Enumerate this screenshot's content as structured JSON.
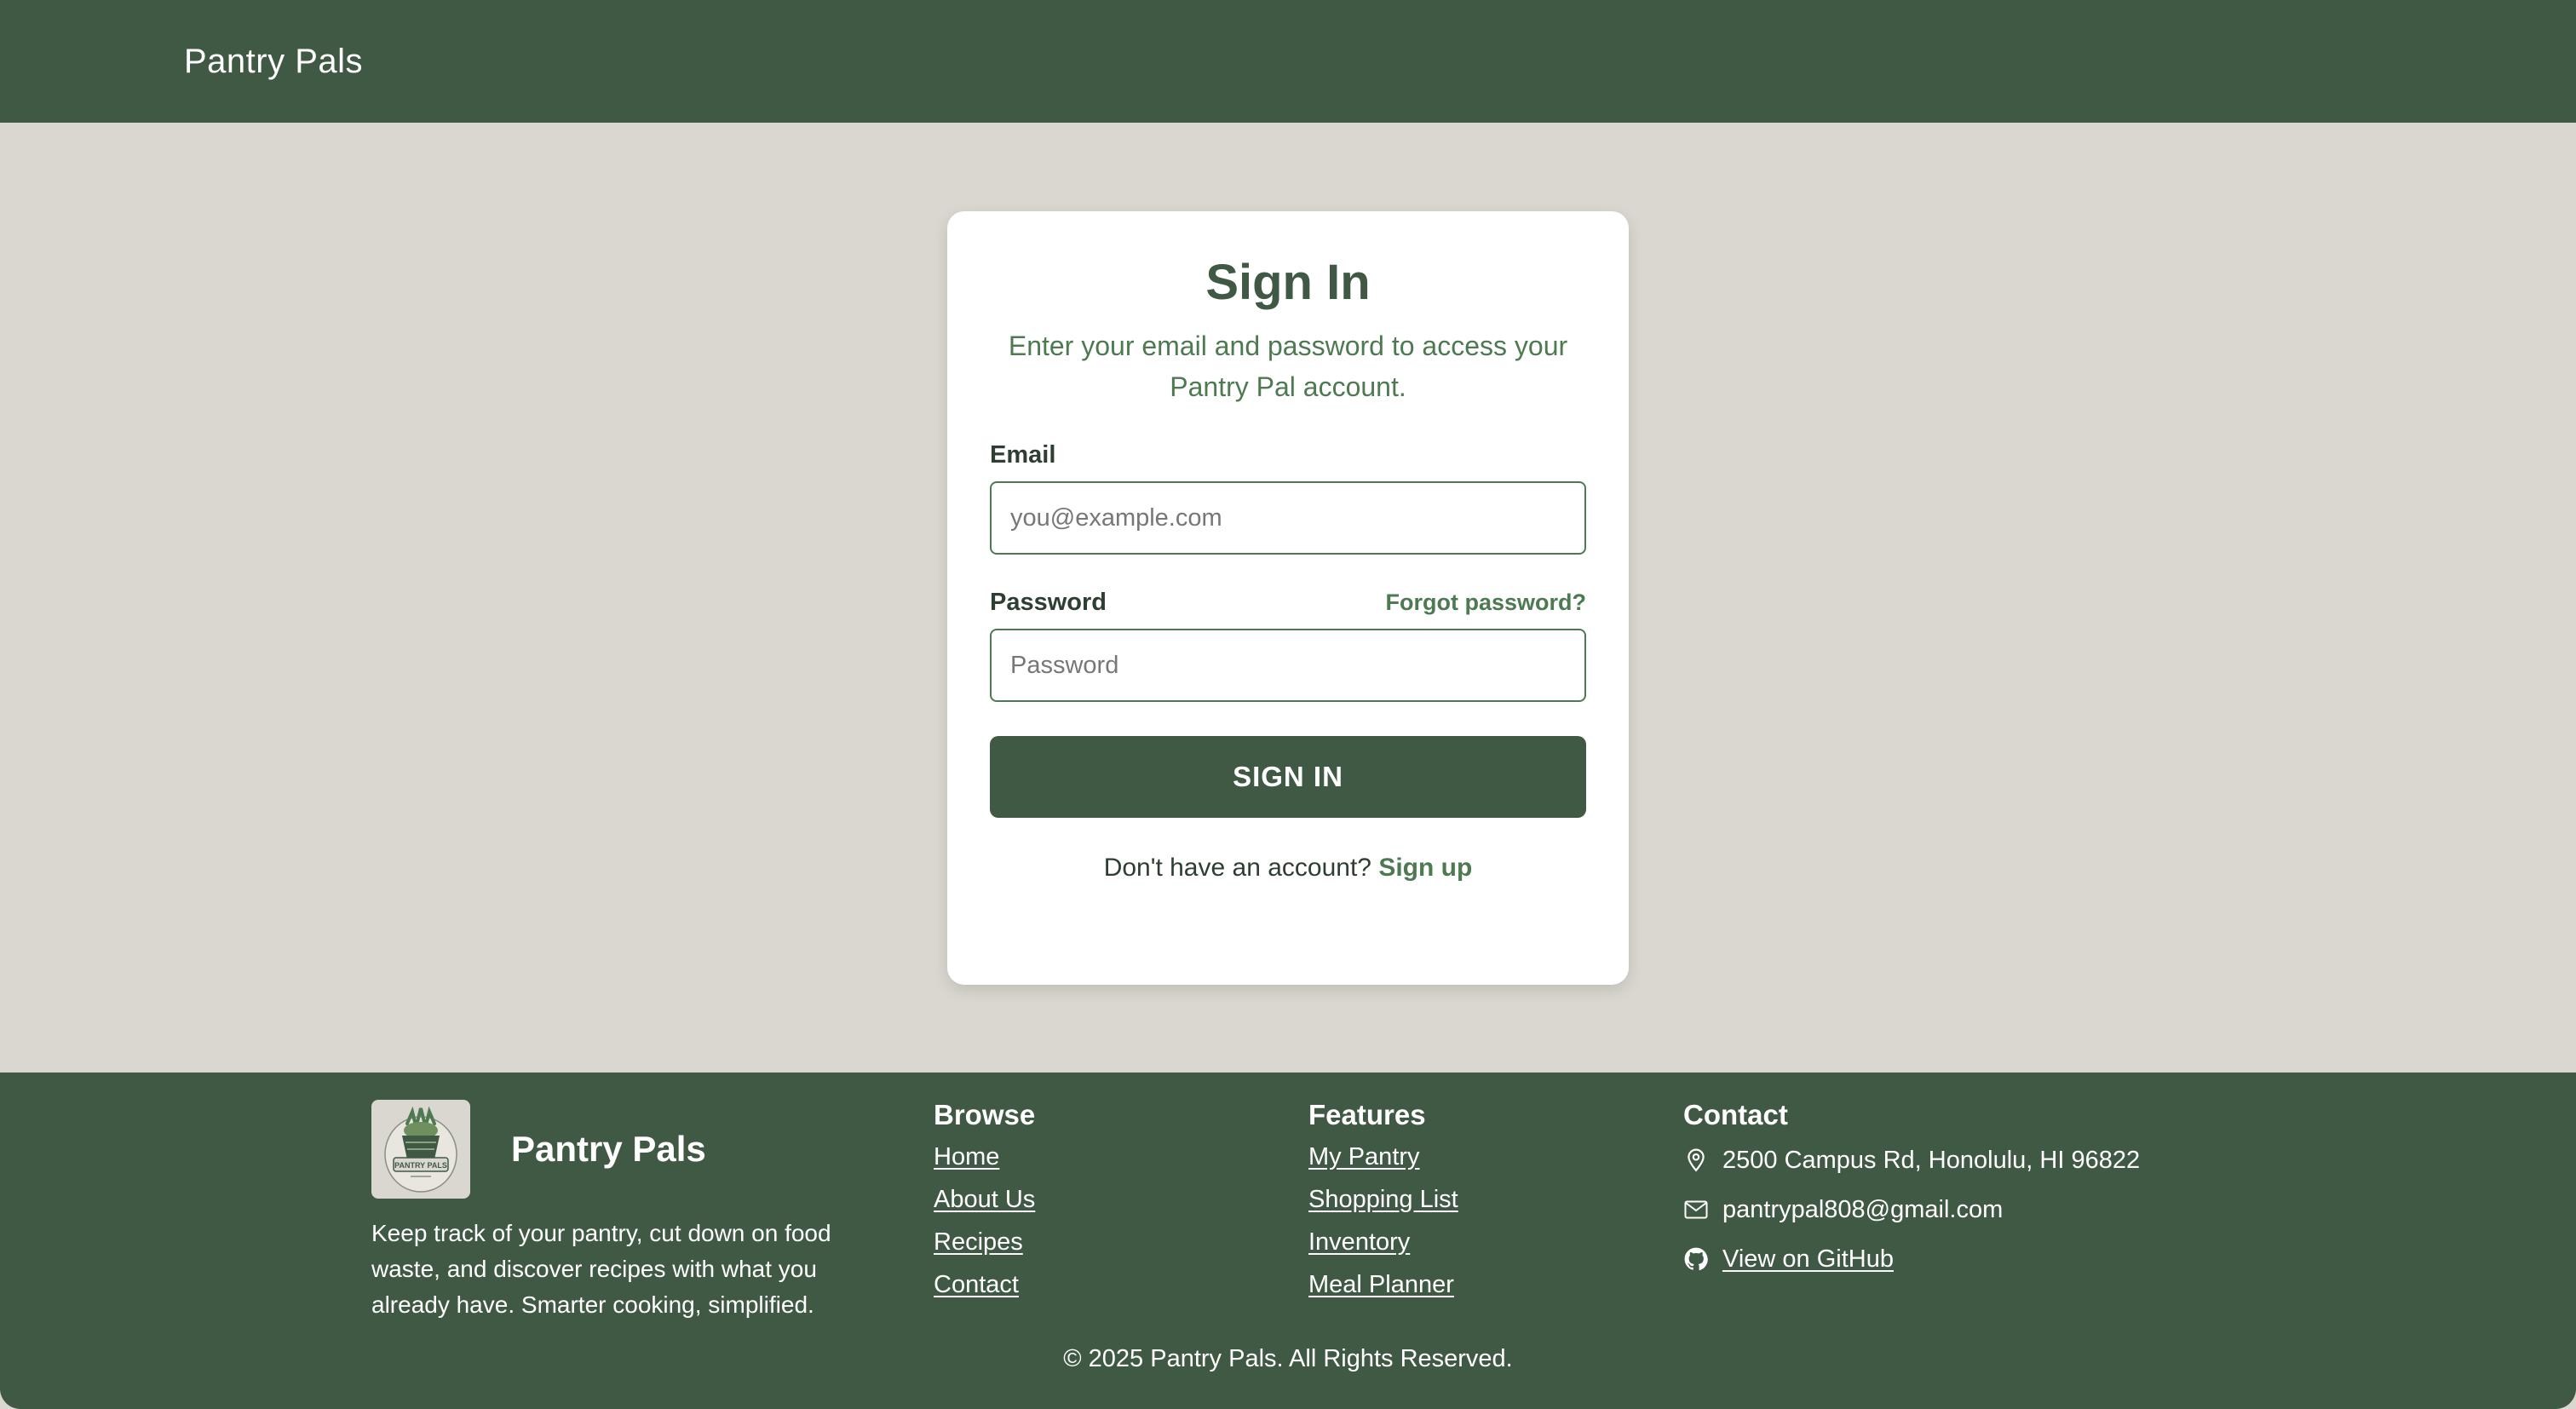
{
  "header": {
    "brand": "Pantry Pals"
  },
  "signin": {
    "title": "Sign In",
    "subtitle": "Enter your email and password to access your Pantry Pal account.",
    "email_label": "Email",
    "email_value": "",
    "email_placeholder": "you@example.com",
    "password_label": "Password",
    "forgot_label": "Forgot password?",
    "password_value": "",
    "password_placeholder": "Password",
    "submit_label": "SIGN IN",
    "signup_prompt": "Don't have an account?",
    "signup_label": "Sign up"
  },
  "footer": {
    "brand_name": "Pantry Pals",
    "logo_text": "PANTRY PALS",
    "description": "Keep track of your pantry, cut down on food waste, and discover recipes with what you already have. Smarter cooking, simplified.",
    "browse": {
      "title": "Browse",
      "links": [
        "Home",
        "About Us",
        "Recipes",
        "Contact"
      ]
    },
    "features": {
      "title": "Features",
      "links": [
        "My Pantry",
        "Shopping List",
        "Inventory",
        "Meal Planner"
      ]
    },
    "contact": {
      "title": "Contact",
      "address": "2500 Campus Rd, Honolulu, HI 96822",
      "email": "pantrypal808@gmail.com",
      "github": "View on GitHub",
      "icons": [
        "map-pin-icon",
        "mail-icon",
        "github-icon"
      ]
    },
    "copyright": "© 2025 Pantry Pals. All Rights Reserved."
  },
  "colors": {
    "primary": "#405944",
    "accent": "#4e7a52",
    "background": "#dad7d0",
    "card": "#ffffff"
  }
}
